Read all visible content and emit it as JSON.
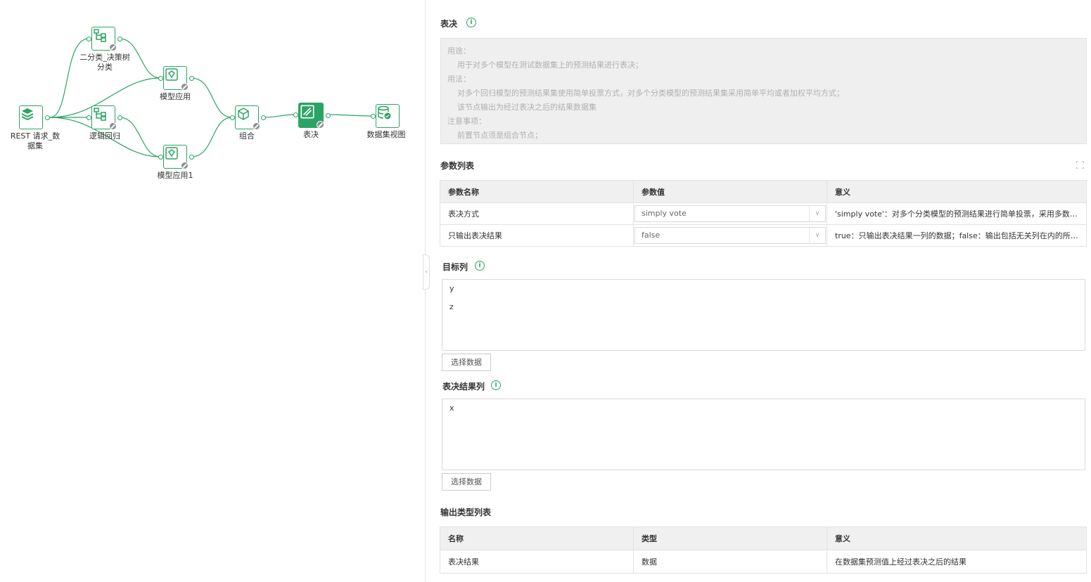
{
  "canvas": {
    "nodes": {
      "rest": {
        "label_line1": "REST 请求_数",
        "label_line2": "据集"
      },
      "tree": {
        "label_line1": "二分类_决策树",
        "label_line2": "分类"
      },
      "logit": {
        "label": "逻辑回归"
      },
      "apply1": {
        "label": "模型应用"
      },
      "apply2": {
        "label": "模型应用1"
      },
      "combine": {
        "label": "组合"
      },
      "vote": {
        "label": "表决"
      },
      "view": {
        "label": "数据集视图"
      }
    },
    "colors": {
      "accent": "#2aa464",
      "badge": "#8f8f8f"
    }
  },
  "panel": {
    "title": "表决",
    "info_icon": "i",
    "description": {
      "usage_label": "用途：",
      "usage_text": "用于对多个模型在测试数据集上的预测结果进行表决；",
      "method_label": "用法：",
      "method_text1": "对多个回归模型的预测结果集使用简单投票方式，对多个分类模型的预测结果集采用简单平均或者加权平均方式；",
      "method_text2": "该节点输出为经过表决之后的结果数据集",
      "note_label": "注意事项：",
      "note_text": "前置节点须是组合节点；"
    },
    "params": {
      "title": "参数列表",
      "headers": [
        "参数名称",
        "参数值",
        "意义"
      ],
      "rows": [
        {
          "name": "表决方式",
          "value": "simply vote",
          "meaning": "'simply vote'：对多个分类模型的预测结果进行简单投票，采用多数投票原则进行表决"
        },
        {
          "name": "只输出表决结果",
          "value": "false",
          "meaning": "true：只输出表决结果一列的数据；false：输出包括无关列在内的所有数据"
        }
      ]
    },
    "target": {
      "title": "目标列",
      "values": [
        "y",
        "z"
      ],
      "button": "选择数据"
    },
    "result": {
      "title": "表决结果列",
      "values": [
        "x"
      ],
      "button": "选择数据"
    },
    "output": {
      "title": "输出类型列表",
      "headers": [
        "名称",
        "类型",
        "意义"
      ],
      "rows": [
        {
          "name": "表决结果",
          "type": "数据",
          "meaning": "在数据集预测值上经过表决之后的结果"
        }
      ]
    }
  }
}
